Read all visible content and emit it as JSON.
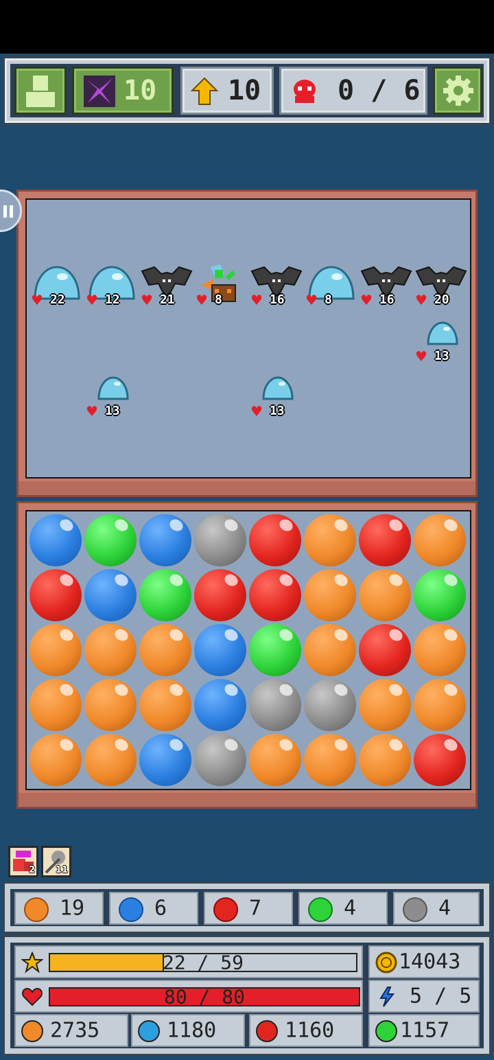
{
  "hud": {
    "portal_count": "10",
    "level": "10",
    "enemies_killed": "0 / 6"
  },
  "enemies": [
    {
      "type": "slime",
      "hp": "22"
    },
    {
      "type": "slime",
      "hp": "12"
    },
    {
      "type": "bat",
      "hp": "21"
    },
    {
      "type": "shaman",
      "hp": "8"
    },
    {
      "type": "bat",
      "hp": "16"
    },
    {
      "type": "slime",
      "hp": "8"
    },
    {
      "type": "bat",
      "hp": "16"
    },
    {
      "type": "bat",
      "hp": "20"
    },
    {
      "type": "slime-small",
      "hp": "13"
    },
    {
      "type": "slime-small",
      "hp": "13"
    },
    {
      "type": "slime-small",
      "hp": "13"
    }
  ],
  "board": [
    [
      "blue",
      "green",
      "blue",
      "gray",
      "red",
      "orange",
      "red",
      "orange"
    ],
    [
      "red",
      "blue",
      "green",
      "red",
      "red",
      "orange",
      "orange",
      "green"
    ],
    [
      "orange",
      "orange",
      "orange",
      "blue",
      "green",
      "orange",
      "red",
      "orange"
    ],
    [
      "orange",
      "orange",
      "orange",
      "blue",
      "gray",
      "gray",
      "orange",
      "orange"
    ],
    [
      "orange",
      "orange",
      "blue",
      "gray",
      "orange",
      "orange",
      "orange",
      "red"
    ]
  ],
  "colors": {
    "blue": "#2b7fe0",
    "green": "#2ed33a",
    "red": "#e3251f",
    "orange": "#f0892a",
    "gray": "#8d8d8d"
  },
  "buffs": [
    {
      "icon": "potion-buff-icon",
      "count": "2"
    },
    {
      "icon": "sword-buff-icon",
      "count": "11"
    }
  ],
  "orb_counts": {
    "orange": "19",
    "blue": "6",
    "red": "7",
    "green": "4",
    "gray": "4"
  },
  "stats": {
    "xp": "22 / 59",
    "xp_fraction": 0.373,
    "gold": "14043",
    "hp": "80 / 80",
    "hp_fraction": 1.0,
    "mana": "5 / 5",
    "orange_total": "2735",
    "blue_total": "1180",
    "red_total": "1160",
    "green_total": "1157"
  }
}
